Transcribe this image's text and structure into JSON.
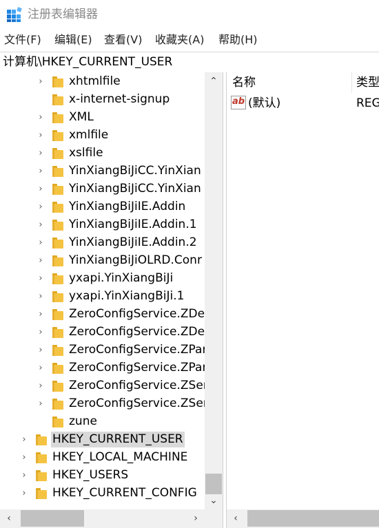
{
  "window": {
    "title": "注册表编辑器"
  },
  "menu": [
    "文件(F)",
    "编辑(E)",
    "查看(V)",
    "收藏夹(A)",
    "帮助(H)"
  ],
  "address": "计算机\\HKEY_CURRENT_USER",
  "tree": {
    "items": [
      {
        "label": "xhtmlfile",
        "expander": "›"
      },
      {
        "label": "x-internet-signup",
        "expander": ""
      },
      {
        "label": "XML",
        "expander": "›"
      },
      {
        "label": "xmlfile",
        "expander": "›"
      },
      {
        "label": "xslfile",
        "expander": "›"
      },
      {
        "label": "YinXiangBiJiCC.YinXian",
        "expander": "›"
      },
      {
        "label": "YinXiangBiJiCC.YinXian",
        "expander": "›"
      },
      {
        "label": "YinXiangBiJiIE.Addin",
        "expander": "›"
      },
      {
        "label": "YinXiangBiJiIE.Addin.1",
        "expander": "›"
      },
      {
        "label": "YinXiangBiJiIE.Addin.2",
        "expander": "›"
      },
      {
        "label": "YinXiangBiJiOLRD.Conr",
        "expander": "›"
      },
      {
        "label": "yxapi.YinXiangBiJi",
        "expander": "›"
      },
      {
        "label": "yxapi.YinXiangBiJi.1",
        "expander": "›"
      },
      {
        "label": "ZeroConfigService.ZDe",
        "expander": "›"
      },
      {
        "label": "ZeroConfigService.ZDe",
        "expander": "›"
      },
      {
        "label": "ZeroConfigService.ZPar",
        "expander": "›"
      },
      {
        "label": "ZeroConfigService.ZPar",
        "expander": "›"
      },
      {
        "label": "ZeroConfigService.ZSer",
        "expander": "›"
      },
      {
        "label": "ZeroConfigService.ZSer",
        "expander": "›"
      },
      {
        "label": "zune",
        "expander": ""
      },
      {
        "label": "HKEY_CURRENT_USER",
        "expander": "›",
        "selected": true
      },
      {
        "label": "HKEY_LOCAL_MACHINE",
        "expander": "›"
      },
      {
        "label": "HKEY_USERS",
        "expander": "›"
      },
      {
        "label": "HKEY_CURRENT_CONFIG",
        "expander": "›"
      }
    ]
  },
  "scroll": {
    "up": "⌃",
    "down": "⌄",
    "left": "‹",
    "right": "›"
  },
  "list": {
    "headers": {
      "name": "名称",
      "type": "类型"
    },
    "rows": [
      {
        "icon": "ab",
        "name": "(默认)",
        "type": "REG"
      }
    ]
  },
  "colors": {
    "folder": "#f5c342",
    "selection": "#d9d9d9",
    "scrollbar": "#f0f0f0",
    "thumb": "#c1c1c1"
  },
  "icons": {
    "app": "regedit-icon",
    "folder": "folder-icon",
    "value": "string-value-icon"
  }
}
